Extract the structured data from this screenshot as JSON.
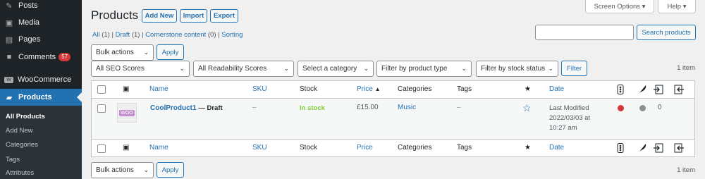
{
  "sidebar": {
    "menu": [
      {
        "label": "Posts",
        "icon": "pin-icon"
      },
      {
        "label": "Media",
        "icon": "media-icon"
      },
      {
        "label": "Pages",
        "icon": "pages-icon"
      },
      {
        "label": "Comments",
        "icon": "comments-icon",
        "badge": "57"
      },
      {
        "label": "WooCommerce",
        "icon": "woocommerce-icon"
      },
      {
        "label": "Products",
        "icon": "products-icon"
      }
    ],
    "submenu": [
      "All Products",
      "Add New",
      "Categories",
      "Tags",
      "Attributes"
    ]
  },
  "header": {
    "title": "Products",
    "add_new": "Add New",
    "import": "Import",
    "export": "Export",
    "screen_options": "Screen Options",
    "help": "Help"
  },
  "views": {
    "all": "All",
    "all_count": "(1)",
    "draft": "Draft",
    "draft_count": "(1)",
    "cornerstone": "Cornerstone content",
    "cornerstone_count": "(0)",
    "sorting": "Sorting"
  },
  "search": {
    "value": "",
    "button": "Search products"
  },
  "bulk": {
    "label": "Bulk actions",
    "apply": "Apply"
  },
  "filters": {
    "seo": "All SEO Scores",
    "readability": "All Readability Scores",
    "category": "Select a category",
    "product_type": "Filter by product type",
    "stock_status": "Filter by stock status",
    "button": "Filter"
  },
  "item_count": "1 item",
  "columns": {
    "name": "Name",
    "sku": "SKU",
    "stock": "Stock",
    "price": "Price",
    "categories": "Categories",
    "tags": "Tags",
    "date": "Date"
  },
  "rows": [
    {
      "name": "CoolProduct1",
      "state": "— Draft",
      "thumb_label": "WOO",
      "sku": "–",
      "stock": "In stock",
      "price": "£15.00",
      "category": "Music",
      "tags": "–",
      "date_line1": "Last Modified",
      "date_line2": "2022/03/03 at",
      "date_line3": "10:27 am",
      "links_count": "0",
      "seo_color": "#d63638",
      "readability_color": "#8c8f94"
    }
  ],
  "colors": {
    "accent": "#2271b1",
    "sidebar_bg": "#1d2327",
    "in_stock": "#7ad03a",
    "badge": "#d63638"
  }
}
